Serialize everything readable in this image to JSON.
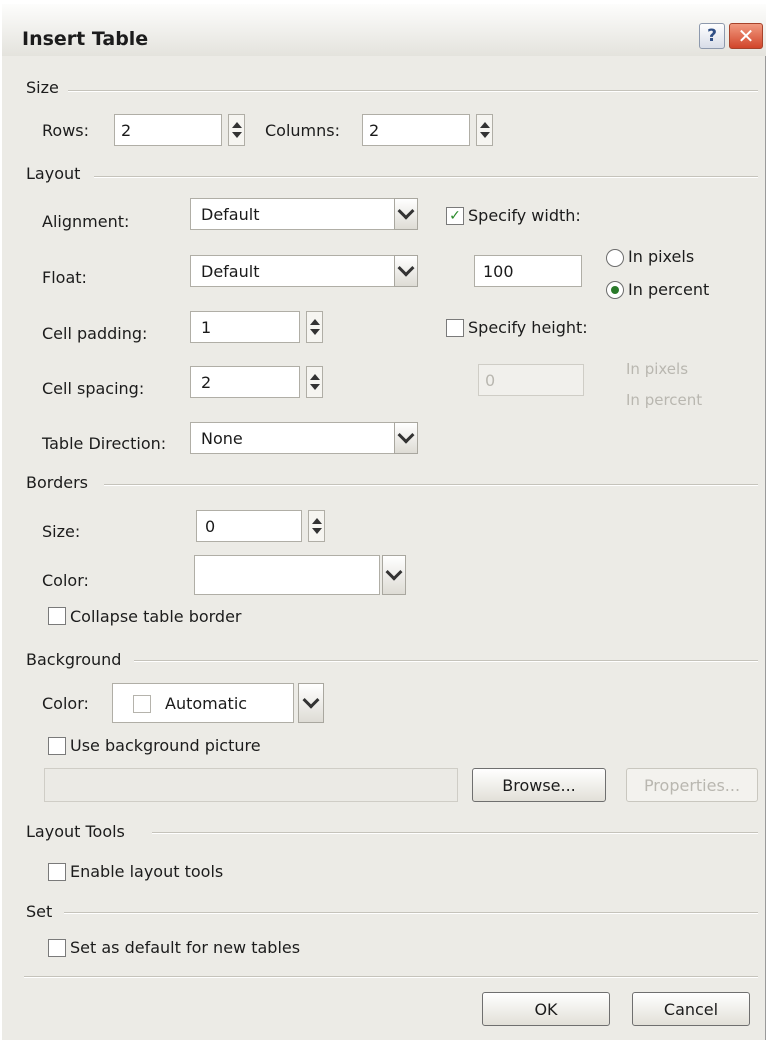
{
  "window": {
    "title": "Insert Table",
    "help_label": "?",
    "close_label": "✕"
  },
  "size": {
    "heading": "Size",
    "rows_label": "Rows:",
    "rows_value": "2",
    "columns_label": "Columns:",
    "columns_value": "2"
  },
  "layout": {
    "heading": "Layout",
    "alignment_label": "Alignment:",
    "alignment_value": "Default",
    "float_label": "Float:",
    "float_value": "Default",
    "cell_padding_label": "Cell padding:",
    "cell_padding_value": "1",
    "cell_spacing_label": "Cell spacing:",
    "cell_spacing_value": "2",
    "direction_label": "Table Direction:",
    "direction_value": "None",
    "specify_width_label": "Specify width:",
    "specify_width_checked": true,
    "width_value": "100",
    "width_in_pixels_label": "In pixels",
    "width_in_percent_label": "In percent",
    "width_unit_selected": "percent",
    "specify_height_label": "Specify height:",
    "specify_height_checked": false,
    "height_value": "0",
    "height_in_pixels_label": "In pixels",
    "height_in_percent_label": "In percent"
  },
  "borders": {
    "heading": "Borders",
    "size_label": "Size:",
    "size_value": "0",
    "color_label": "Color:",
    "color_value": "",
    "collapse_label": "Collapse table border",
    "collapse_checked": false
  },
  "background": {
    "heading": "Background",
    "color_label": "Color:",
    "color_value": "Automatic",
    "use_picture_label": "Use background picture",
    "use_picture_checked": false,
    "picture_path": "",
    "browse_label": "Browse...",
    "properties_label": "Properties..."
  },
  "layout_tools": {
    "heading": "Layout Tools",
    "enable_label": "Enable layout tools",
    "enable_checked": false
  },
  "set": {
    "heading": "Set",
    "default_label": "Set as default for new tables",
    "default_checked": false
  },
  "buttons": {
    "ok_label": "OK",
    "cancel_label": "Cancel"
  }
}
